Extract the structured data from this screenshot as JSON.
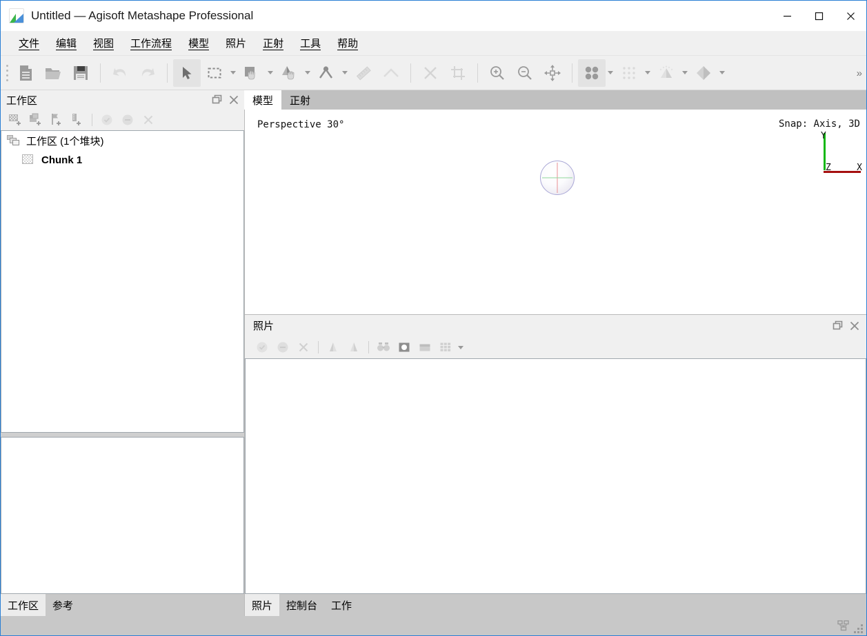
{
  "window": {
    "title": "Untitled — Agisoft Metashape Professional",
    "app_icon": "metashape-logo-icon",
    "controls": {
      "minimize": "minimize-icon",
      "maximize": "maximize-icon",
      "close": "close-icon"
    }
  },
  "menubar": {
    "items": [
      {
        "label": "文件",
        "mnemonic": "文"
      },
      {
        "label": "编辑",
        "mnemonic": "编"
      },
      {
        "label": "视图",
        "mnemonic": "视"
      },
      {
        "label": "工作流程",
        "mnemonic": "工作"
      },
      {
        "label": "模型",
        "mnemonic": "模"
      },
      {
        "label": "照片",
        "mnemonic": ""
      },
      {
        "label": "正射",
        "mnemonic": "正"
      },
      {
        "label": "工具",
        "mnemonic": "工"
      },
      {
        "label": "帮助",
        "mnemonic": "帮"
      }
    ]
  },
  "toolbar": {
    "buttons": [
      {
        "name": "new-document-icon",
        "enabled": true
      },
      {
        "name": "open-folder-icon",
        "enabled": true
      },
      {
        "name": "save-icon",
        "enabled": true
      },
      {
        "name": "undo-icon",
        "enabled": false
      },
      {
        "name": "redo-icon",
        "enabled": false
      },
      {
        "name": "select-arrow-icon",
        "enabled": true,
        "active": true
      },
      {
        "name": "rectangle-selection-icon",
        "enabled": true,
        "dropdown": true
      },
      {
        "name": "move-region-icon",
        "enabled": true,
        "dropdown": true
      },
      {
        "name": "resize-region-icon",
        "enabled": true,
        "dropdown": true
      },
      {
        "name": "rotate-region-icon",
        "enabled": true,
        "dropdown": true
      },
      {
        "name": "ruler-icon",
        "enabled": false
      },
      {
        "name": "draw-polyline-icon",
        "enabled": false
      },
      {
        "name": "delete-icon",
        "enabled": false
      },
      {
        "name": "crop-icon",
        "enabled": false
      },
      {
        "name": "zoom-in-icon",
        "enabled": true
      },
      {
        "name": "zoom-out-icon",
        "enabled": true
      },
      {
        "name": "reset-view-icon",
        "enabled": true
      },
      {
        "name": "point-cloud-icon",
        "enabled": true,
        "active": true,
        "dropdown": true
      },
      {
        "name": "dense-cloud-icon",
        "enabled": false,
        "dropdown": true
      },
      {
        "name": "mesh-shaded-icon",
        "enabled": false,
        "dropdown": true
      },
      {
        "name": "model-solid-icon",
        "enabled": false,
        "dropdown": true
      }
    ],
    "overflow_label": "»"
  },
  "workspace_panel": {
    "title": "工作区",
    "float_button": "float-panel-icon",
    "close_button": "close-panel-icon",
    "toolbar": [
      {
        "name": "add-chunk-icon",
        "enabled": true
      },
      {
        "name": "add-photos-icon",
        "enabled": true
      },
      {
        "name": "add-markers-icon",
        "enabled": true
      },
      {
        "name": "add-camera-icon",
        "enabled": true
      },
      {
        "name": "enable-icon",
        "enabled": false
      },
      {
        "name": "disable-icon",
        "enabled": false
      },
      {
        "name": "remove-icon",
        "enabled": false
      }
    ],
    "tree": [
      {
        "label": "工作区 (1个堆块)",
        "icon": "workspace-root-icon",
        "bold": false,
        "level": 0
      },
      {
        "label": "Chunk 1",
        "icon": "chunk-icon",
        "bold": true,
        "level": 1
      }
    ]
  },
  "left_dock_tabs": [
    {
      "label": "工作区",
      "active": true
    },
    {
      "label": "参考",
      "active": false
    }
  ],
  "view_tabs": [
    {
      "label": "模型",
      "active": true
    },
    {
      "label": "正射",
      "active": false
    }
  ],
  "viewport": {
    "projection_label": "Perspective 30°",
    "snap_label": "Snap: Axis, 3D",
    "navigation_sphere": "navigation-sphere-icon",
    "axes": {
      "x_label": "X",
      "y_label": "Y",
      "z_label": "Z",
      "x_color": "#a50f0f",
      "y_color": "#12b812",
      "z_color": "#1414c8"
    }
  },
  "photos_panel": {
    "title": "照片",
    "float_button": "float-panel-icon",
    "close_button": "close-panel-icon",
    "toolbar": [
      {
        "name": "enable-photo-icon",
        "enabled": false
      },
      {
        "name": "disable-photo-icon",
        "enabled": false
      },
      {
        "name": "remove-photo-icon",
        "enabled": false
      },
      {
        "name": "rotate-left-icon",
        "enabled": false
      },
      {
        "name": "rotate-right-icon",
        "enabled": false
      },
      {
        "name": "match-photos-icon",
        "enabled": false
      },
      {
        "name": "photo-view-icon",
        "enabled": false
      },
      {
        "name": "thumbnail-icon",
        "enabled": false
      },
      {
        "name": "grid-view-icon",
        "enabled": false,
        "dropdown": true
      }
    ]
  },
  "bottom_tabs": [
    {
      "label": "照片",
      "active": true
    },
    {
      "label": "控制台",
      "active": false
    },
    {
      "label": "工作",
      "active": false
    }
  ],
  "statusbar": {
    "network_icon": "network-monitor-icon",
    "resize_grip": "resize-grip-icon"
  }
}
